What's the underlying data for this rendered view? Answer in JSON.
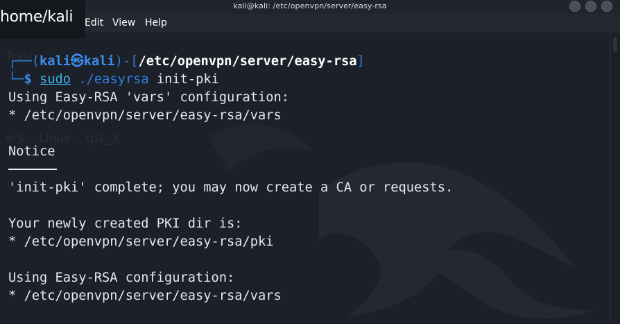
{
  "window": {
    "title": "kali@kali: /etc/openvpn/server/easy-rsa"
  },
  "menu": {
    "items": [
      "Edit",
      "View",
      "Help"
    ]
  },
  "overlay": {
    "text": "home/kali"
  },
  "background_ghost": {
    "text_1": "Trash",
    "text_2": "e S...  Linux...  tp1_3"
  },
  "prompt": {
    "open": "┌──(",
    "user": "kali",
    "at": "㉿",
    "host": "kali",
    "mid": ")-[",
    "cwd": "/etc/openvpn/server/easy-rsa",
    "close": "]",
    "corner": "└─",
    "dollar": "$",
    "cmd_sudo": "sudo",
    "cmd_path": "./easyrsa",
    "cmd_args": " init-pki"
  },
  "output": {
    "line1": "Using Easy-RSA 'vars' configuration:",
    "line2": "* /etc/openvpn/server/easy-rsa/vars",
    "line3": "Notice",
    "line4": "'init-pki' complete; you may now create a CA or requests.",
    "line5": "Your newly created PKI dir is:",
    "line6": "* /etc/openvpn/server/easy-rsa/pki",
    "line7": "Using Easy-RSA configuration:",
    "line8": "* /etc/openvpn/server/easy-rsa/vars"
  },
  "colors": {
    "prompt_blue": "#2f7fe0",
    "text": "#e6e8ec",
    "background": "#1c2029"
  }
}
